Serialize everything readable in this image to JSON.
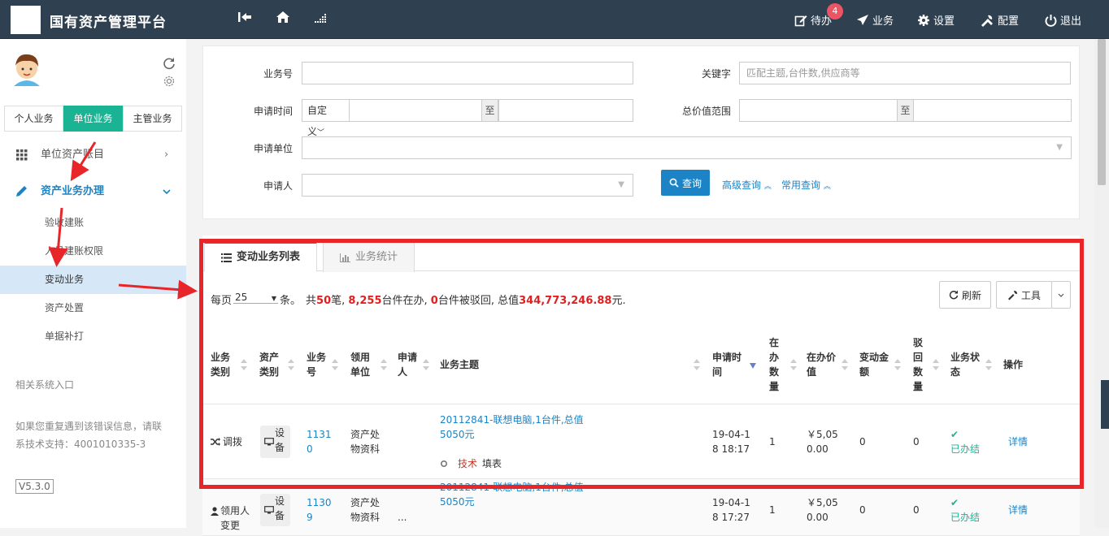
{
  "app": {
    "title": "国有资产管理平台"
  },
  "topbar": {
    "todo_label": "待办",
    "todo_badge": "4",
    "business_label": "业务",
    "settings_label": "设置",
    "config_label": "配置",
    "logout_label": "退出"
  },
  "sidebar": {
    "tabs": [
      {
        "label": "个人业务",
        "active": false
      },
      {
        "label": "单位业务",
        "active": true
      },
      {
        "label": "主管业务",
        "active": false
      }
    ],
    "menu": [
      {
        "label": "单位资产账目"
      },
      {
        "label": "资产业务办理"
      }
    ],
    "submenu": [
      {
        "label": "验收建账"
      },
      {
        "label": "人员建账权限"
      },
      {
        "label": "变动业务",
        "active": true
      },
      {
        "label": "资产处置"
      },
      {
        "label": "单据补打"
      }
    ],
    "related_label": "相关系统入口",
    "help_line1": "如果您重复遇到该错误信息，请联",
    "help_line2": "系技术支持：4001010335-3",
    "version": "V5.3.0"
  },
  "search": {
    "business_no_label": "业务号",
    "keyword_label": "关键字",
    "keyword_placeholder": "匹配主题,台件数,供应商等",
    "apply_time_label": "申请时间",
    "apply_time_mode": "自定义",
    "to_label": "至",
    "total_value_label": "总价值范围",
    "apply_unit_label": "申请单位",
    "applicant_label": "申请人",
    "query_button": "查询",
    "advanced_query": "高级查询",
    "common_query": "常用查询"
  },
  "list": {
    "tabs": [
      {
        "label": "变动业务列表",
        "active": true
      },
      {
        "label": "业务统计",
        "active": false
      }
    ],
    "per_page_label": "每页",
    "per_page_value": "25",
    "per_page_unit": "条。",
    "summary": {
      "prefix": "共",
      "count": "50",
      "count_unit": "笔, ",
      "in_progress": "8,255",
      "in_progress_unit": "台件在办, ",
      "rejected": "0",
      "rejected_unit": "台件被驳回, 总值",
      "total_value": "344,773,246.88",
      "total_unit": "元."
    },
    "refresh_button": "刷新",
    "tools_button": "工具",
    "columns": {
      "biz_type": "业务类别",
      "asset_type": "资产类别",
      "biz_no": "业务号",
      "unit": "领用单位",
      "applicant": "申请人",
      "subject": "业务主题",
      "apply_time": "申请时间",
      "qty": "在办数量",
      "value": "在办价值",
      "change_amount": "变动金额",
      "reject_qty": "驳回数量",
      "status": "业务状态",
      "action": "操作"
    },
    "rows": [
      {
        "biz_type": "调拨",
        "asset_type": "设备",
        "biz_no": "11310",
        "unit": "资产处物资科",
        "subject": "20112841-联想电脑,1台件,总值5050元",
        "step_role": "技术",
        "step_action": "填表",
        "apply_time": "19-04-18 18:17",
        "qty": "1",
        "value": "￥5,050.00",
        "change_amount": "0",
        "reject_qty": "0",
        "status": "已办结",
        "action": "详情"
      },
      {
        "biz_type": "领用人变更",
        "asset_type": "设备",
        "biz_no": "11309",
        "unit": "资产处物资科",
        "applicant": "...",
        "subject": "20112841-联想电脑,1台件,总值5050元",
        "apply_time": "19-04-18 17:27",
        "qty": "1",
        "value": "￥5,050.00",
        "change_amount": "0",
        "reject_qty": "0",
        "status": "已办结",
        "action": "详情"
      }
    ]
  },
  "colors": {
    "sidebar_active": "#1ab394",
    "link": "#1c84c6",
    "highlight": "#e8262a",
    "topbar": "#2f4050"
  }
}
